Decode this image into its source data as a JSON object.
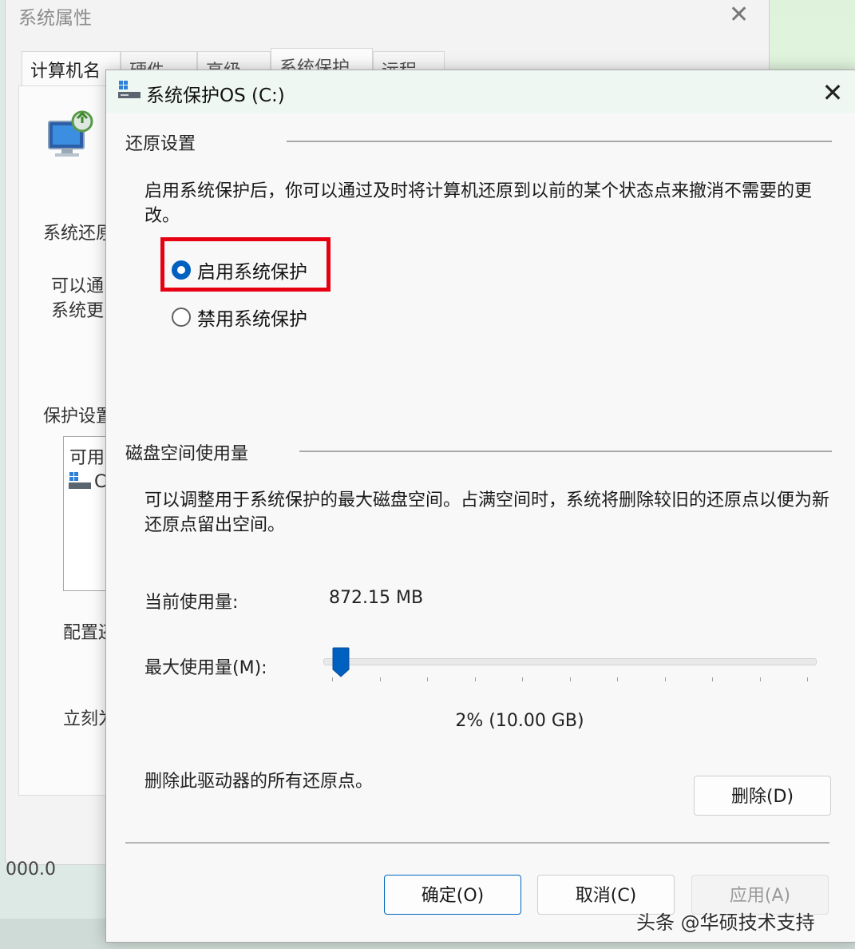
{
  "back_window": {
    "title": "系统属性",
    "close_glyph": "✕",
    "tabs": [
      "计算机名",
      "硬件",
      "高级",
      "系统保护",
      "远程"
    ],
    "section_restore": "系统还原",
    "desc_line1": "可以通",
    "desc_line2": "系统更",
    "section_protect": "保护设置",
    "list_header": "可用",
    "list_item": "C",
    "configure": "配置还",
    "create_now": "立刻为",
    "footer_value": "000.0"
  },
  "dialog": {
    "title": "系统保护OS (C:)",
    "close_glyph": "✕",
    "restore_settings": {
      "heading": "还原设置",
      "description": "启用系统保护后，你可以通过及时将计算机还原到以前的某个状态点来撤消不需要的更改。",
      "options": [
        {
          "label": "启用系统保护",
          "checked": true
        },
        {
          "label": "禁用系统保护",
          "checked": false
        }
      ]
    },
    "disk_usage": {
      "heading": "磁盘空间使用量",
      "description": "可以调整用于系统保护的最大磁盘空间。占满空间时，系统将删除较旧的还原点以便为新还原点留出空间。",
      "current_label": "当前使用量:",
      "current_value": "872.15 MB",
      "max_label": "最大使用量(M):",
      "slider_percent": 2,
      "slider_text": "2% (10.00 GB)",
      "delete_text": "删除此驱动器的所有还原点。",
      "delete_button": "删除(D)"
    },
    "buttons": {
      "ok": "确定(O)",
      "cancel": "取消(C)",
      "apply": "应用(A)"
    }
  },
  "watermark": "头条 @华硕技术支持",
  "colors": {
    "accent": "#0060c0",
    "highlight": "#e60012"
  }
}
